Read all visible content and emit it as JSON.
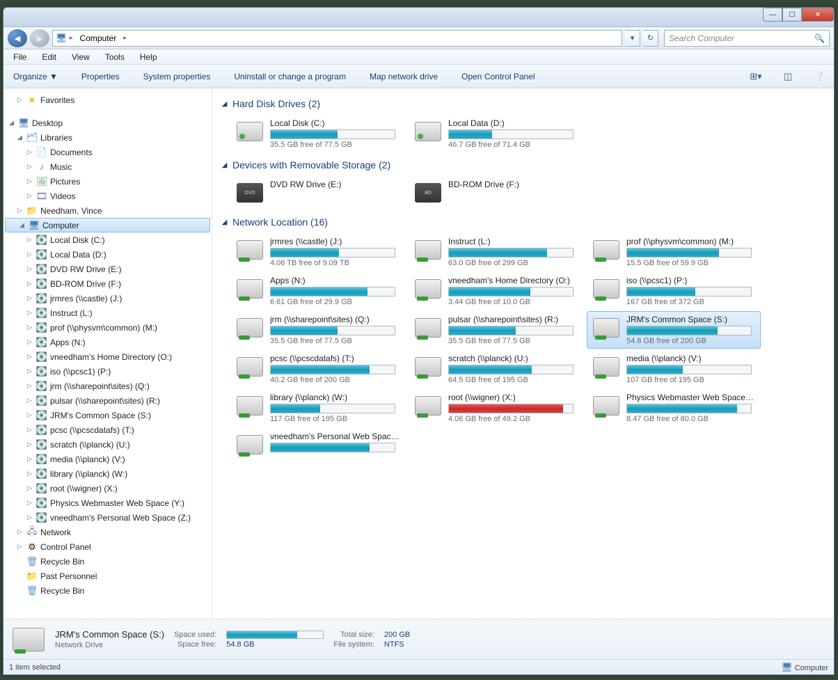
{
  "window": {
    "title": "Computer"
  },
  "nav": {
    "breadcrumb_seg": "Computer",
    "search_placeholder": "Search Computer"
  },
  "menu": [
    "File",
    "Edit",
    "View",
    "Tools",
    "Help"
  ],
  "toolbar": {
    "organize": "Organize ▼",
    "properties": "Properties",
    "system_properties": "System properties",
    "uninstall": "Uninstall or change a program",
    "map_drive": "Map network drive",
    "control_panel": "Open Control Panel"
  },
  "sidebar": {
    "favorites": "Favorites",
    "desktop": "Desktop",
    "libraries": "Libraries",
    "documents": "Documents",
    "music": "Music",
    "pictures": "Pictures",
    "videos": "Videos",
    "user": "Needham, Vince",
    "computer": "Computer",
    "network": "Network",
    "control_panel": "Control Panel",
    "recycle_bin": "Recycle Bin",
    "past_personnel": "Past Personnel",
    "recycle_bin2": "Recycle Bin",
    "drives": [
      "Local Disk (C:)",
      "Local Data (D:)",
      "DVD RW Drive (E:)",
      "BD-ROM Drive (F:)",
      "jrmres (\\\\castle) (J:)",
      "Instruct (L:)",
      "prof (\\\\physvm\\common) (M:)",
      "Apps (N:)",
      "vneedham's  Home Directory (O:)",
      "iso (\\\\pcsc1) (P:)",
      "jrm (\\\\sharepoint\\sites) (Q:)",
      "pulsar (\\\\sharepoint\\sites) (R:)",
      "JRM's Common Space (S:)",
      "pcsc (\\\\pcscdatafs) (T:)",
      "scratch (\\\\planck) (U:)",
      "media (\\\\planck) (V:)",
      "library (\\\\planck) (W:)",
      "root (\\\\wigner) (X:)",
      "Physics Webmaster Web Space (Y:)",
      "vneedham's  Personal Web Space (Z:)"
    ]
  },
  "sections": {
    "hdd": "Hard Disk Drives (2)",
    "removable": "Devices with Removable Storage (2)",
    "network": "Network Location (16)"
  },
  "hdd": [
    {
      "name": "Local Disk (C:)",
      "stat": "35.5 GB free of 77.5 GB",
      "pct": 54
    },
    {
      "name": "Local Data (D:)",
      "stat": "46.7 GB free of 71.4 GB",
      "pct": 35
    }
  ],
  "removable": [
    {
      "name": "DVD RW Drive (E:)",
      "label": "DVD"
    },
    {
      "name": "BD-ROM Drive (F:)",
      "label": "BD"
    }
  ],
  "netdrives": [
    {
      "name": "jrmres (\\\\castle) (J:)",
      "stat": "4.06 TB free of 9.09 TB",
      "pct": 55
    },
    {
      "name": "Instruct (L:)",
      "stat": "63.0 GB free of 299 GB",
      "pct": 79
    },
    {
      "name": "prof (\\\\physvm\\common) (M:)",
      "stat": "15.5 GB free of 59.9 GB",
      "pct": 74
    },
    {
      "name": "Apps (N:)",
      "stat": "6.61 GB free of 29.9 GB",
      "pct": 78
    },
    {
      "name": "vneedham's  Home Directory (O:)",
      "stat": "3.44 GB free of 10.0 GB",
      "pct": 66
    },
    {
      "name": "iso (\\\\pcsc1) (P:)",
      "stat": "167 GB free of 372 GB",
      "pct": 55
    },
    {
      "name": "jrm (\\\\sharepoint\\sites) (Q:)",
      "stat": "35.5 GB free of 77.5 GB",
      "pct": 54
    },
    {
      "name": "pulsar (\\\\sharepoint\\sites) (R:)",
      "stat": "35.5 GB free of 77.5 GB",
      "pct": 54
    },
    {
      "name": "JRM's Common Space (S:)",
      "stat": "54.8 GB free of 200 GB",
      "pct": 73,
      "selected": true
    },
    {
      "name": "pcsc (\\\\pcscdatafs) (T:)",
      "stat": "40.2 GB free of 200 GB",
      "pct": 80
    },
    {
      "name": "scratch (\\\\planck) (U:)",
      "stat": "64.5 GB free of 195 GB",
      "pct": 67
    },
    {
      "name": "media (\\\\planck) (V:)",
      "stat": "107 GB free of 195 GB",
      "pct": 45
    },
    {
      "name": "library (\\\\planck) (W:)",
      "stat": "117 GB free of 195 GB",
      "pct": 40
    },
    {
      "name": "root (\\\\wigner) (X:)",
      "stat": "4.06 GB free of 49.2 GB",
      "pct": 92,
      "red": true
    },
    {
      "name": "Physics Webmaster Web Space (Y:)",
      "stat": "8.47 GB free of 80.0 GB",
      "pct": 89
    },
    {
      "name": "vneedham's  Personal Web Space (Z:)",
      "stat": "",
      "pct": 80
    }
  ],
  "details": {
    "title": "JRM's Common Space (S:)",
    "subtitle": "Network Drive",
    "used_lbl": "Space used:",
    "free_lbl": "Space free:",
    "free_val": "54.8 GB",
    "size_lbl": "Total size:",
    "size_val": "200 GB",
    "fs_lbl": "File system:",
    "fs_val": "NTFS",
    "pct": 73
  },
  "status": {
    "left": "1 item selected",
    "right": "Computer"
  }
}
